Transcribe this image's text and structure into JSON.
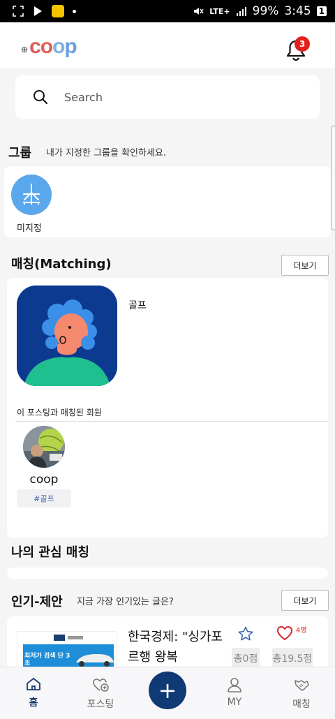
{
  "status_bar": {
    "battery": "99%",
    "time": "3:45",
    "network": "LTE+",
    "sim_badge": "1"
  },
  "header": {
    "logo": "coop",
    "notification_count": "3"
  },
  "search": {
    "placeholder": "Search"
  },
  "groups": {
    "title": "그룹",
    "subtitle": "내가 지정한 그룹을 확인하세요.",
    "items": [
      {
        "label": "미지정",
        "icon": "airplane-icon"
      }
    ]
  },
  "matching": {
    "title": "매칭(Matching)",
    "more_label": "더보기",
    "post_title": "골프",
    "matched_members_label": "이 포스팅과 매칭된 회원",
    "members": [
      {
        "name": "coop",
        "tag": "#골프"
      }
    ]
  },
  "my_interest": {
    "title": "나의 관심 매칭"
  },
  "popular": {
    "title": "인기-제안",
    "subtitle": "지금 가장 인기있는 글은?",
    "more_label": "더보기",
    "posts": [
      {
        "title": "한국경제: \"싱가포르행 왕복",
        "heart_count": "4명",
        "total_star": "총0점",
        "total_heart": "총19.5점",
        "thumb_banner": "최저가 검색 단 3초"
      }
    ]
  },
  "bottom_nav": {
    "items": [
      {
        "label": "홈",
        "icon": "home-icon",
        "active": true
      },
      {
        "label": "포스팅",
        "icon": "posting-icon",
        "active": false
      },
      {
        "label": "MY",
        "icon": "person-icon",
        "active": false
      },
      {
        "label": "매칭",
        "icon": "handshake-icon",
        "active": false
      }
    ],
    "fab_label": "+"
  },
  "colors": {
    "accent": "#0f3a73",
    "badge": "#e3201b",
    "group_avatar": "#5aa7ec"
  }
}
